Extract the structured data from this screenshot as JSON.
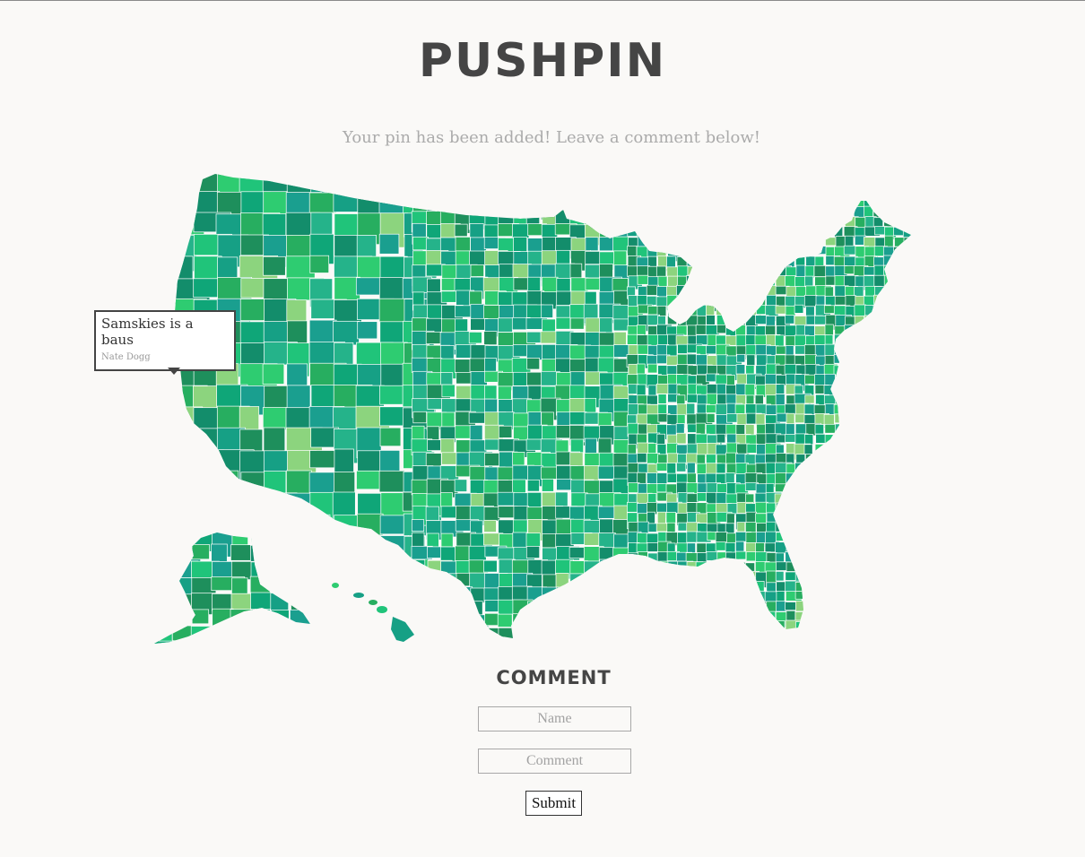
{
  "header": {
    "title": "PUSHPIN",
    "subtitle": "Your pin has been added! Leave a comment below!"
  },
  "map": {
    "palette": [
      "#1a9f8f",
      "#16a085",
      "#27ae60",
      "#2ecc71",
      "#20c47a",
      "#1e8f5c",
      "#8cd47e",
      "#0fa678",
      "#25b38a",
      "#138d6b"
    ],
    "border_color": "#ffffff",
    "pin": {
      "comment": "Samskies is a baus",
      "author": "Nate Dogg"
    }
  },
  "comment_form": {
    "heading": "COMMENT",
    "name_placeholder": "Name",
    "comment_placeholder": "Comment",
    "submit_label": "Submit"
  }
}
